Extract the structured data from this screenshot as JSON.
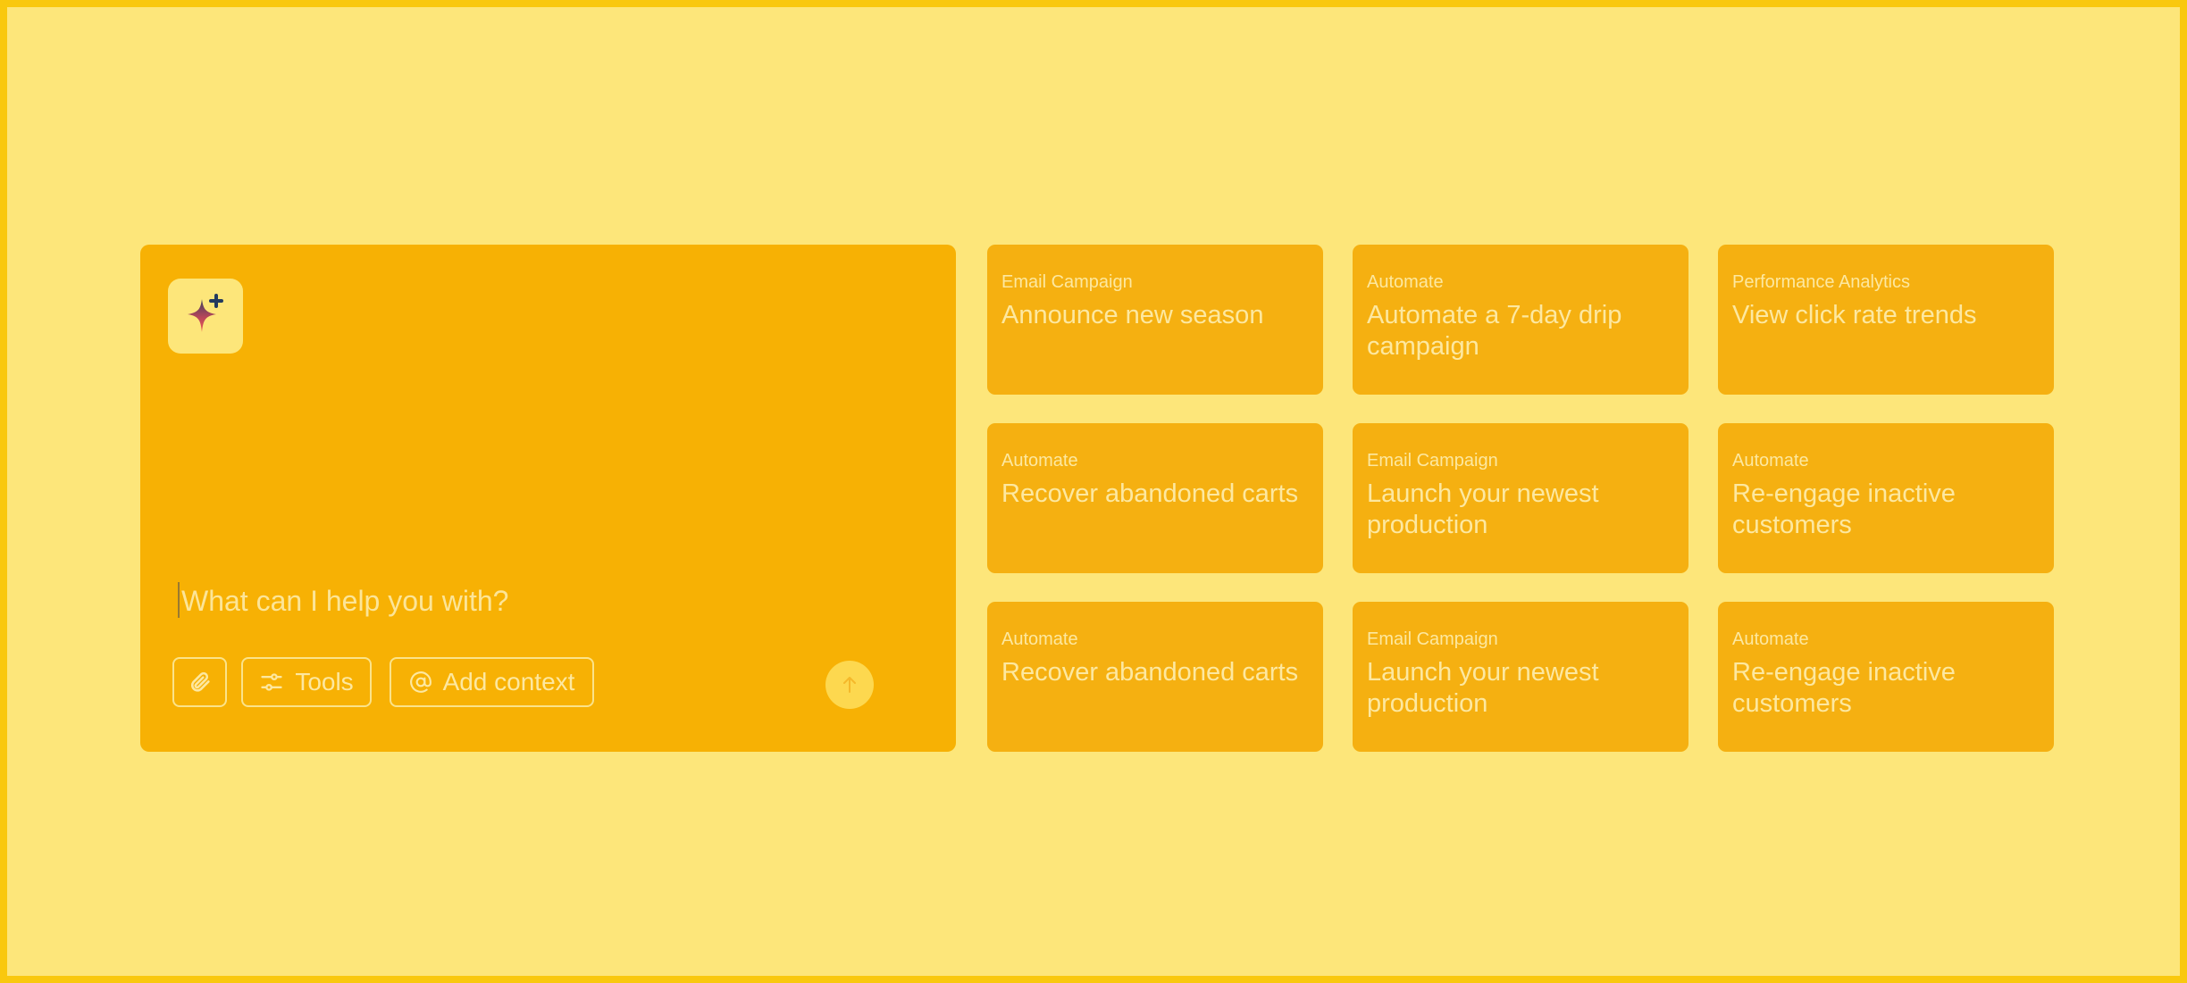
{
  "composer": {
    "placeholder": "What can I help you with?",
    "value": "",
    "logo_icon": "sparkle-plus-icon",
    "attach_icon": "paperclip-icon",
    "tools_icon": "sliders-icon",
    "tools_label": "Tools",
    "context_icon": "at-sign-icon",
    "context_label": "Add context",
    "send_icon": "arrow-up-icon"
  },
  "suggestions": [
    {
      "category": "Email Campaign",
      "title": "Announce new season"
    },
    {
      "category": "Automate",
      "title": "Automate a 7-day drip campaign"
    },
    {
      "category": "Performance Analytics",
      "title": "View click rate trends"
    },
    {
      "category": "Automate",
      "title": "Recover abandoned carts"
    },
    {
      "category": "Email Campaign",
      "title": "Launch your newest production"
    },
    {
      "category": "Automate",
      "title": "Re-engage inactive customers"
    },
    {
      "category": "Automate",
      "title": "Recover abandoned carts"
    },
    {
      "category": "Email Campaign",
      "title": "Launch your newest production"
    },
    {
      "category": "Automate",
      "title": "Re-engage inactive customers"
    }
  ],
  "colors": {
    "background": "#fde67a",
    "border": "#f9c80e",
    "panel": "#f7b104",
    "card": "#f5b011",
    "text": "#fde8a0"
  }
}
